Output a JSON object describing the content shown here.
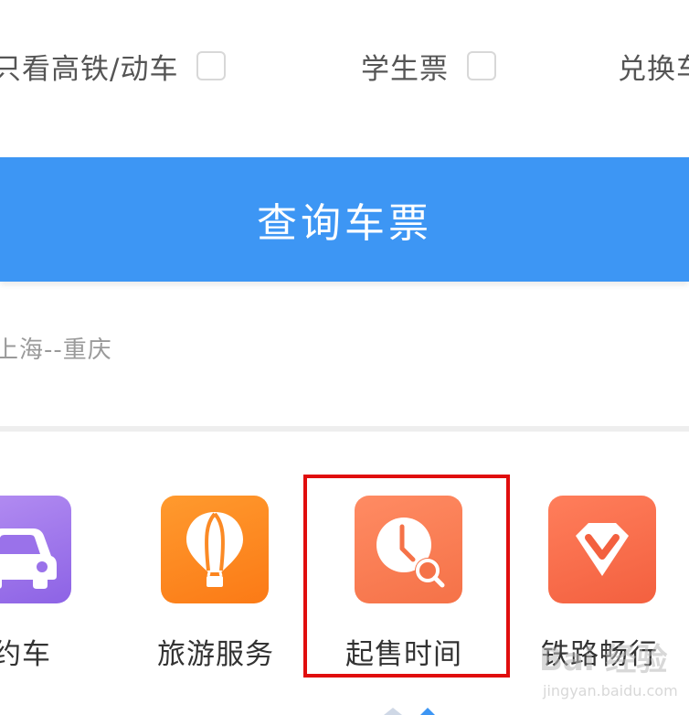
{
  "options": {
    "high_speed_label": "只看高铁/动车",
    "student_label": "学生票",
    "exchange_label": "兑换车"
  },
  "query_button_label": "查询车票",
  "history_text": "上海--重庆",
  "services": [
    {
      "label": "约车",
      "icon": "car-icon"
    },
    {
      "label": "旅游服务",
      "icon": "hot-air-balloon-icon"
    },
    {
      "label": "起售时间",
      "icon": "clock-search-icon"
    },
    {
      "label": "铁路畅行",
      "icon": "diamond-v-icon"
    }
  ],
  "watermark": {
    "text": "Bai 经验",
    "sub": "jingyan.baidu.com"
  },
  "colors": {
    "primary": "#3d96f4",
    "highlight": "#e00d0d",
    "purple": "#8d63e5",
    "orange": "#fb7a16",
    "coral": "#f57248"
  }
}
